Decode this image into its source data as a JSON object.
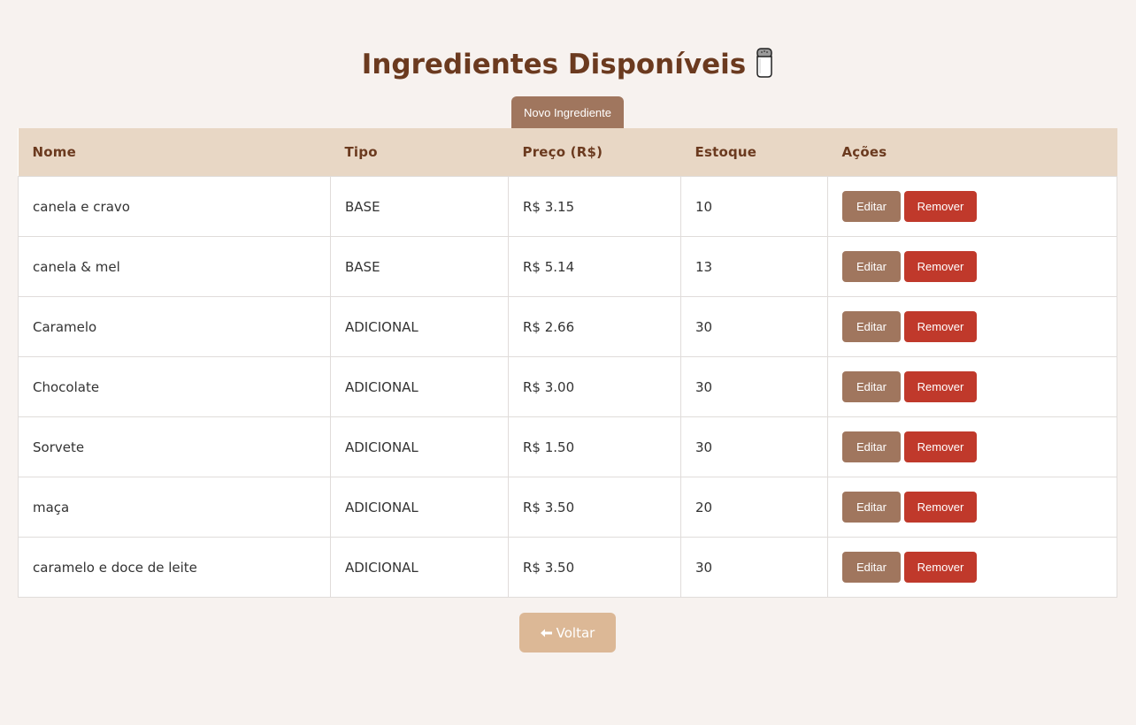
{
  "page": {
    "title": "Ingredientes Disponíveis",
    "title_icon": "salt-shaker-icon"
  },
  "toolbar": {
    "new_label": "Novo Ingrediente"
  },
  "table": {
    "columns": [
      "Nome",
      "Tipo",
      "Preço (R$)",
      "Estoque",
      "Ações"
    ],
    "rows": [
      {
        "nome": "canela e cravo",
        "tipo": "BASE",
        "preco": "R$ 3.15",
        "estoque": "10"
      },
      {
        "nome": "canela & mel",
        "tipo": "BASE",
        "preco": "R$ 5.14",
        "estoque": "13"
      },
      {
        "nome": "Caramelo",
        "tipo": "ADICIONAL",
        "preco": "R$ 2.66",
        "estoque": "30"
      },
      {
        "nome": "Chocolate",
        "tipo": "ADICIONAL",
        "preco": "R$ 3.00",
        "estoque": "30"
      },
      {
        "nome": "Sorvete",
        "tipo": "ADICIONAL",
        "preco": "R$ 1.50",
        "estoque": "30"
      },
      {
        "nome": "maça",
        "tipo": "ADICIONAL",
        "preco": "R$ 3.50",
        "estoque": "20"
      },
      {
        "nome": "caramelo e doce de leite",
        "tipo": "ADICIONAL",
        "preco": "R$ 3.50",
        "estoque": "30"
      }
    ],
    "edit_label": "Editar",
    "remove_label": "Remover"
  },
  "footer": {
    "back_label": "Voltar",
    "back_icon": "arrow-left-icon"
  },
  "colors": {
    "background": "#f7f2ef",
    "title": "#6b3a1f",
    "header_bg": "#e8d7c5",
    "edit_button": "#a0765e",
    "remove_button": "#c0392b",
    "back_button": "#dcb896"
  }
}
